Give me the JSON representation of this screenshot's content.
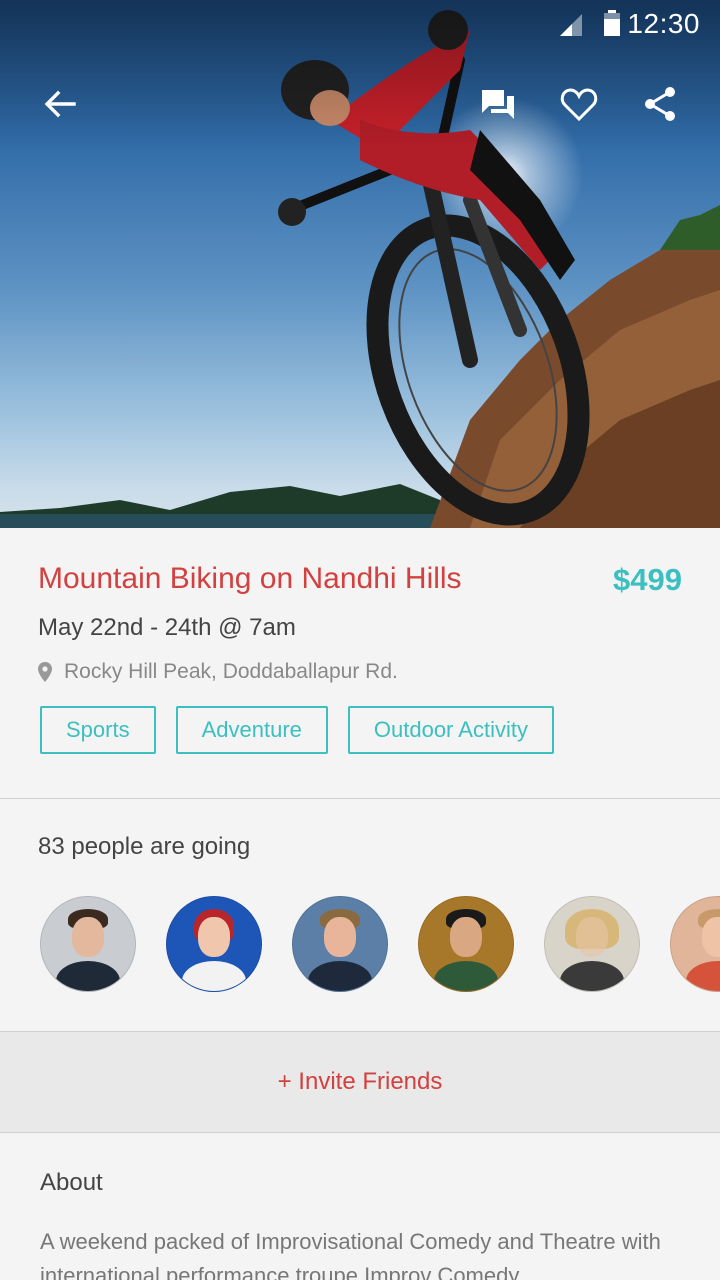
{
  "status_bar": {
    "time": "12:30",
    "signal_icon": "cell-signal-icon",
    "battery_icon": "battery-icon"
  },
  "toolbar": {
    "back_icon": "arrow-back-icon",
    "chat_icon": "chat-icon",
    "favorite_icon": "heart-outline-icon",
    "share_icon": "share-icon"
  },
  "event": {
    "title": "Mountain Biking on Nandhi Hills",
    "price": "$499",
    "date": "May 22nd - 24th @ 7am",
    "location": "Rocky Hill Peak, Doddaballapur Rd.",
    "tags": [
      "Sports",
      "Adventure",
      "Outdoor Activity"
    ]
  },
  "attendees": {
    "count_text": "83 people are going"
  },
  "invite": {
    "label": "+ Invite Friends"
  },
  "about": {
    "heading": "About",
    "text": "A weekend packed of Improvisational Comedy and Theatre with international performance troupe Improv Comedy"
  },
  "colors": {
    "accent_red": "#d2413f",
    "accent_teal": "#3bbfc0"
  }
}
